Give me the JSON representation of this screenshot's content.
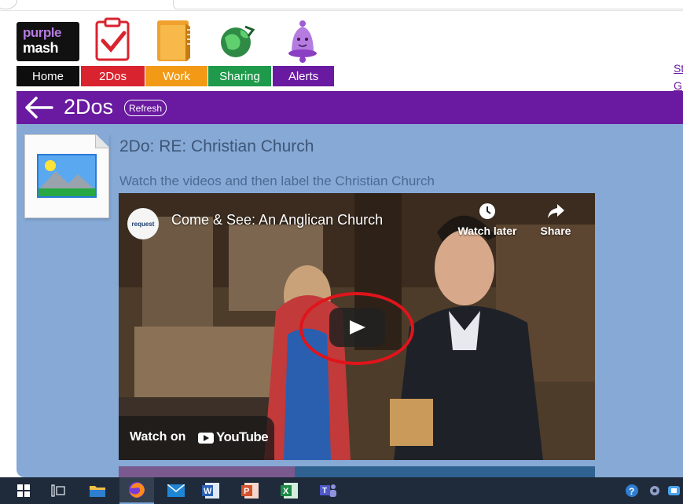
{
  "nav": {
    "logo": {
      "line1": "purple",
      "line2": "mash"
    },
    "tabs": [
      {
        "label": "Home",
        "color": "#0e0e0e"
      },
      {
        "label": "2Dos",
        "color": "#d9232e"
      },
      {
        "label": "Work",
        "color": "#f29a16"
      },
      {
        "label": "Sharing",
        "color": "#1e9a4a"
      },
      {
        "label": "Alerts",
        "color": "#6a1aa0"
      }
    ],
    "icons": [
      "clipboard-check-icon",
      "folder-icon",
      "globe-icon",
      "bell-icon"
    ],
    "side_links": [
      "St",
      "G"
    ]
  },
  "title_bar": {
    "title": "2Dos",
    "refresh_label": "Refresh",
    "color": "#6a1aa0"
  },
  "todo": {
    "title": "2Do: RE: Christian Church",
    "description": "Watch the videos and then label the Christian Church"
  },
  "video": {
    "channel_logo_text": "request",
    "title": "Come & See: An Anglican Church",
    "watch_later_label": "Watch later",
    "share_label": "Share",
    "watch_on_label": "Watch on",
    "youtube_label": "YouTube"
  },
  "taskbar": {
    "items": [
      "start",
      "task-view",
      "file-explorer",
      "firefox",
      "mail",
      "word",
      "powerpoint",
      "excel",
      "teams"
    ],
    "active": "firefox"
  }
}
